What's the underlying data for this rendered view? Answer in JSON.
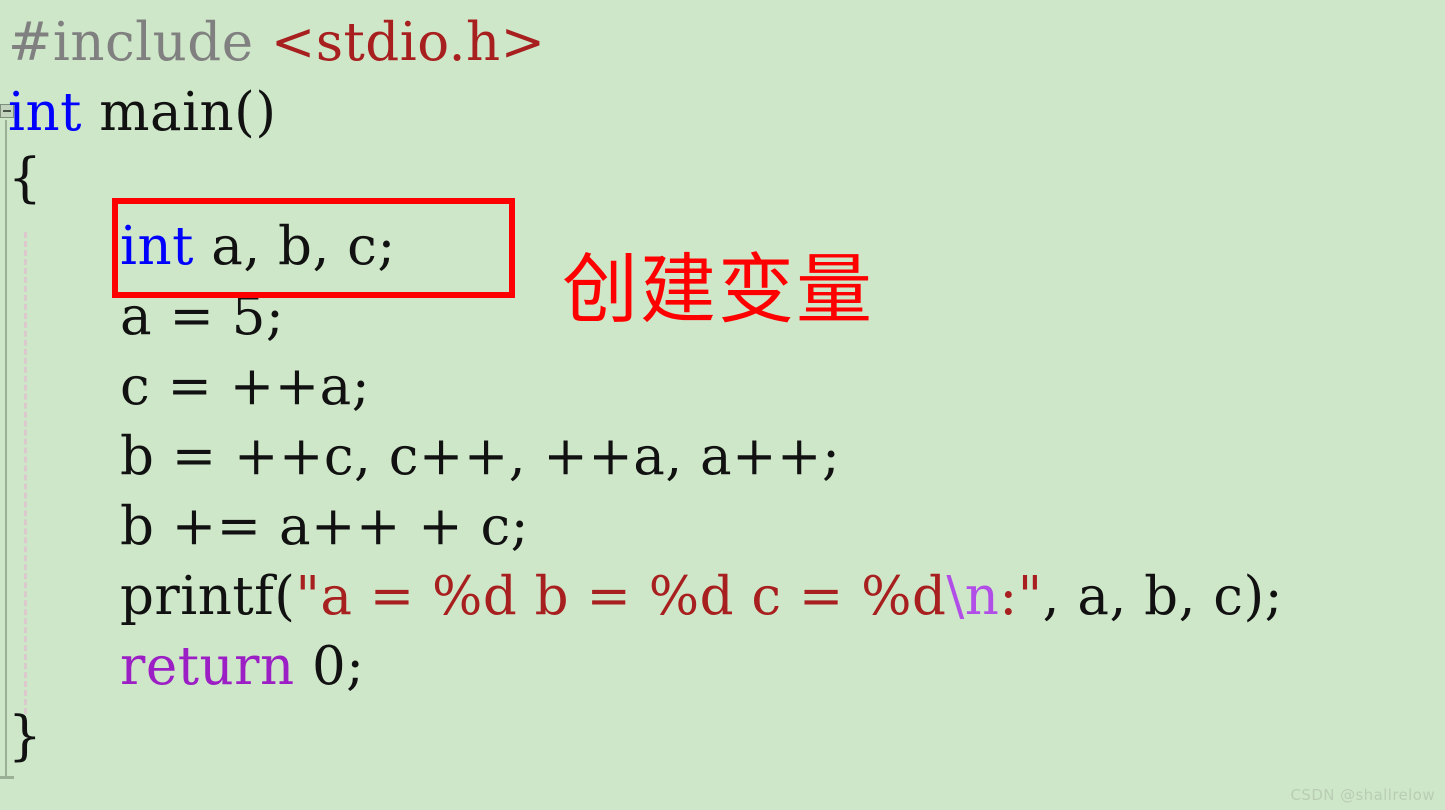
{
  "editor": {
    "background_color": "#cfe7c9",
    "gutter": {
      "fold_marker": "collapse-fold-marker",
      "fold_marker_glyph": "minus",
      "indent_guide": "dashed-indent-guide"
    },
    "code": {
      "line_include": {
        "directive": "#include ",
        "header": "<stdio.h>"
      },
      "line_main": {
        "keyword": "int",
        "rest": " main()"
      },
      "line_open_brace": "{",
      "line_declaration": {
        "keyword": "int",
        "rest": " a, b, c;"
      },
      "line_assign_a": "a = 5;",
      "line_assign_c": "c = ++a;",
      "line_assign_b_multi": "b = ++c, c++, ++a, a++;",
      "line_assign_b_plus": "b += a++ + c;",
      "line_printf": {
        "call": "printf(",
        "quote_open": "\"",
        "format_head": "a = %d b = %d c = %d",
        "escape": "\\n",
        "format_tail": ":",
        "quote_close": "\"",
        "args": ", a, b, c);"
      },
      "line_return": {
        "keyword": "return",
        "rest": " 0;"
      },
      "line_close_brace": "}"
    },
    "colors": {
      "preprocessor": "#808080",
      "header_string": "#a81f1f",
      "keyword": "#0000ff",
      "return_keyword": "#9b1fc4",
      "string_literal": "#a81f1f",
      "escape_sequence": "#b14ee8",
      "plain_text": "#111111"
    }
  },
  "annotation": {
    "text": "创建变量",
    "color": "#ff0000"
  },
  "highlight": {
    "label": "declaration-highlight-box",
    "color": "#ff0000"
  },
  "watermark": {
    "text": "CSDN @shallrelow"
  }
}
